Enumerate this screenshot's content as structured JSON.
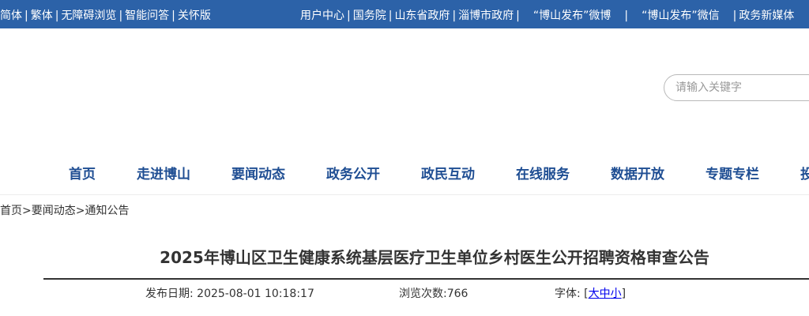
{
  "topbar": {
    "left_links": [
      "简体",
      "繁体",
      "无障碍浏览",
      "智能问答",
      "关怀版"
    ],
    "right_links": [
      "用户中心",
      "国务院",
      "山东省政府",
      "淄博市政府",
      "“博山发布”微博",
      "“博山发布”微信",
      "政务新媒体"
    ]
  },
  "search": {
    "placeholder": "请输入关键字"
  },
  "nav": {
    "items": [
      "首页",
      "走进博山",
      "要闻动态",
      "政务公开",
      "政民互动",
      "在线服务",
      "数据开放",
      "专题专栏",
      "投"
    ]
  },
  "breadcrumb": {
    "items": [
      "首页",
      "要闻动态",
      "通知公告"
    ],
    "separator": ">"
  },
  "article": {
    "title": "2025年博山区卫生健康系统基层医疗卫生单位乡村医生公开招聘资格审查公告",
    "publish_label": "发布日期:",
    "publish_date": "2025-08-01 10:18:17",
    "views_label": "浏览次数:",
    "views": "766",
    "font_label": "字体:",
    "font_open": "[",
    "font_sizes": [
      "大",
      "中",
      "小"
    ],
    "font_close": "]"
  },
  "colors": {
    "topbar_bg": "#2c62a8",
    "nav_text": "#1f4e93"
  }
}
